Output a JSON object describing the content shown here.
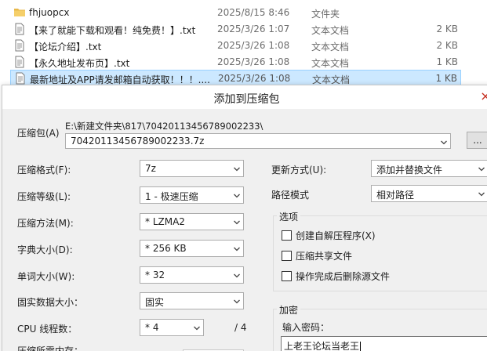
{
  "files": [
    {
      "name": "fhjuopcx",
      "date": "2025/8/15 8:46",
      "type": "文件夹",
      "size": "",
      "icon": "folder-icon",
      "selected": false
    },
    {
      "name": "【来了就能下载和观看！纯免费！】.txt",
      "date": "2025/3/26 1:07",
      "type": "文本文档",
      "size": "2 KB",
      "icon": "text-file-icon",
      "selected": false
    },
    {
      "name": "【论坛介绍】.txt",
      "date": "2025/3/26 1:08",
      "type": "文本文档",
      "size": "2 KB",
      "icon": "text-file-icon",
      "selected": false
    },
    {
      "name": "【永久地址发布页】.txt",
      "date": "2025/3/26 1:08",
      "type": "文本文档",
      "size": "1 KB",
      "icon": "text-file-icon",
      "selected": false
    },
    {
      "name": "最新地址及APP请发邮箱自动获取！！！....",
      "date": "2025/3/26 1:08",
      "type": "文本文档",
      "size": "1 KB",
      "icon": "text-file-icon",
      "selected": true
    }
  ],
  "dialog": {
    "title": "添加到压缩包",
    "close_glyph": "×",
    "archive_label": "压缩包(A)",
    "archive_path": "E:\\新建文件夹\\817\\70420113456789002233\\",
    "archive_name": "70420113456789002233.7z",
    "browse_label": "...",
    "format_label": "压缩格式(F):",
    "format_value": "7z",
    "level_label": "压缩等级(L):",
    "level_value": "1 - 极速压缩",
    "method_label": "压缩方法(M):",
    "method_value": "* LZMA2",
    "dict_label": "字典大小(D):",
    "dict_value": "* 256 KB",
    "word_label": "单词大小(W):",
    "word_value": "* 32",
    "solid_label": "固实数据大小：",
    "solid_value": "固实",
    "cpu_label": "CPU 线程数：",
    "cpu_value": "* 4",
    "cpu_total": "/ 4",
    "mem_label": "压缩所需内存：",
    "update_label": "更新方式(U):",
    "update_value": "添加并替换文件",
    "pathmode_label": "路径模式",
    "pathmode_value": "相对路径",
    "options_title": "选项",
    "opt_sfx": "创建自解压程序(X)",
    "opt_shared": "压缩共享文件",
    "opt_delete": "操作完成后删除源文件",
    "encrypt_title": "加密",
    "password_label": "输入密码：",
    "password_value": "上老王论坛当老王"
  }
}
